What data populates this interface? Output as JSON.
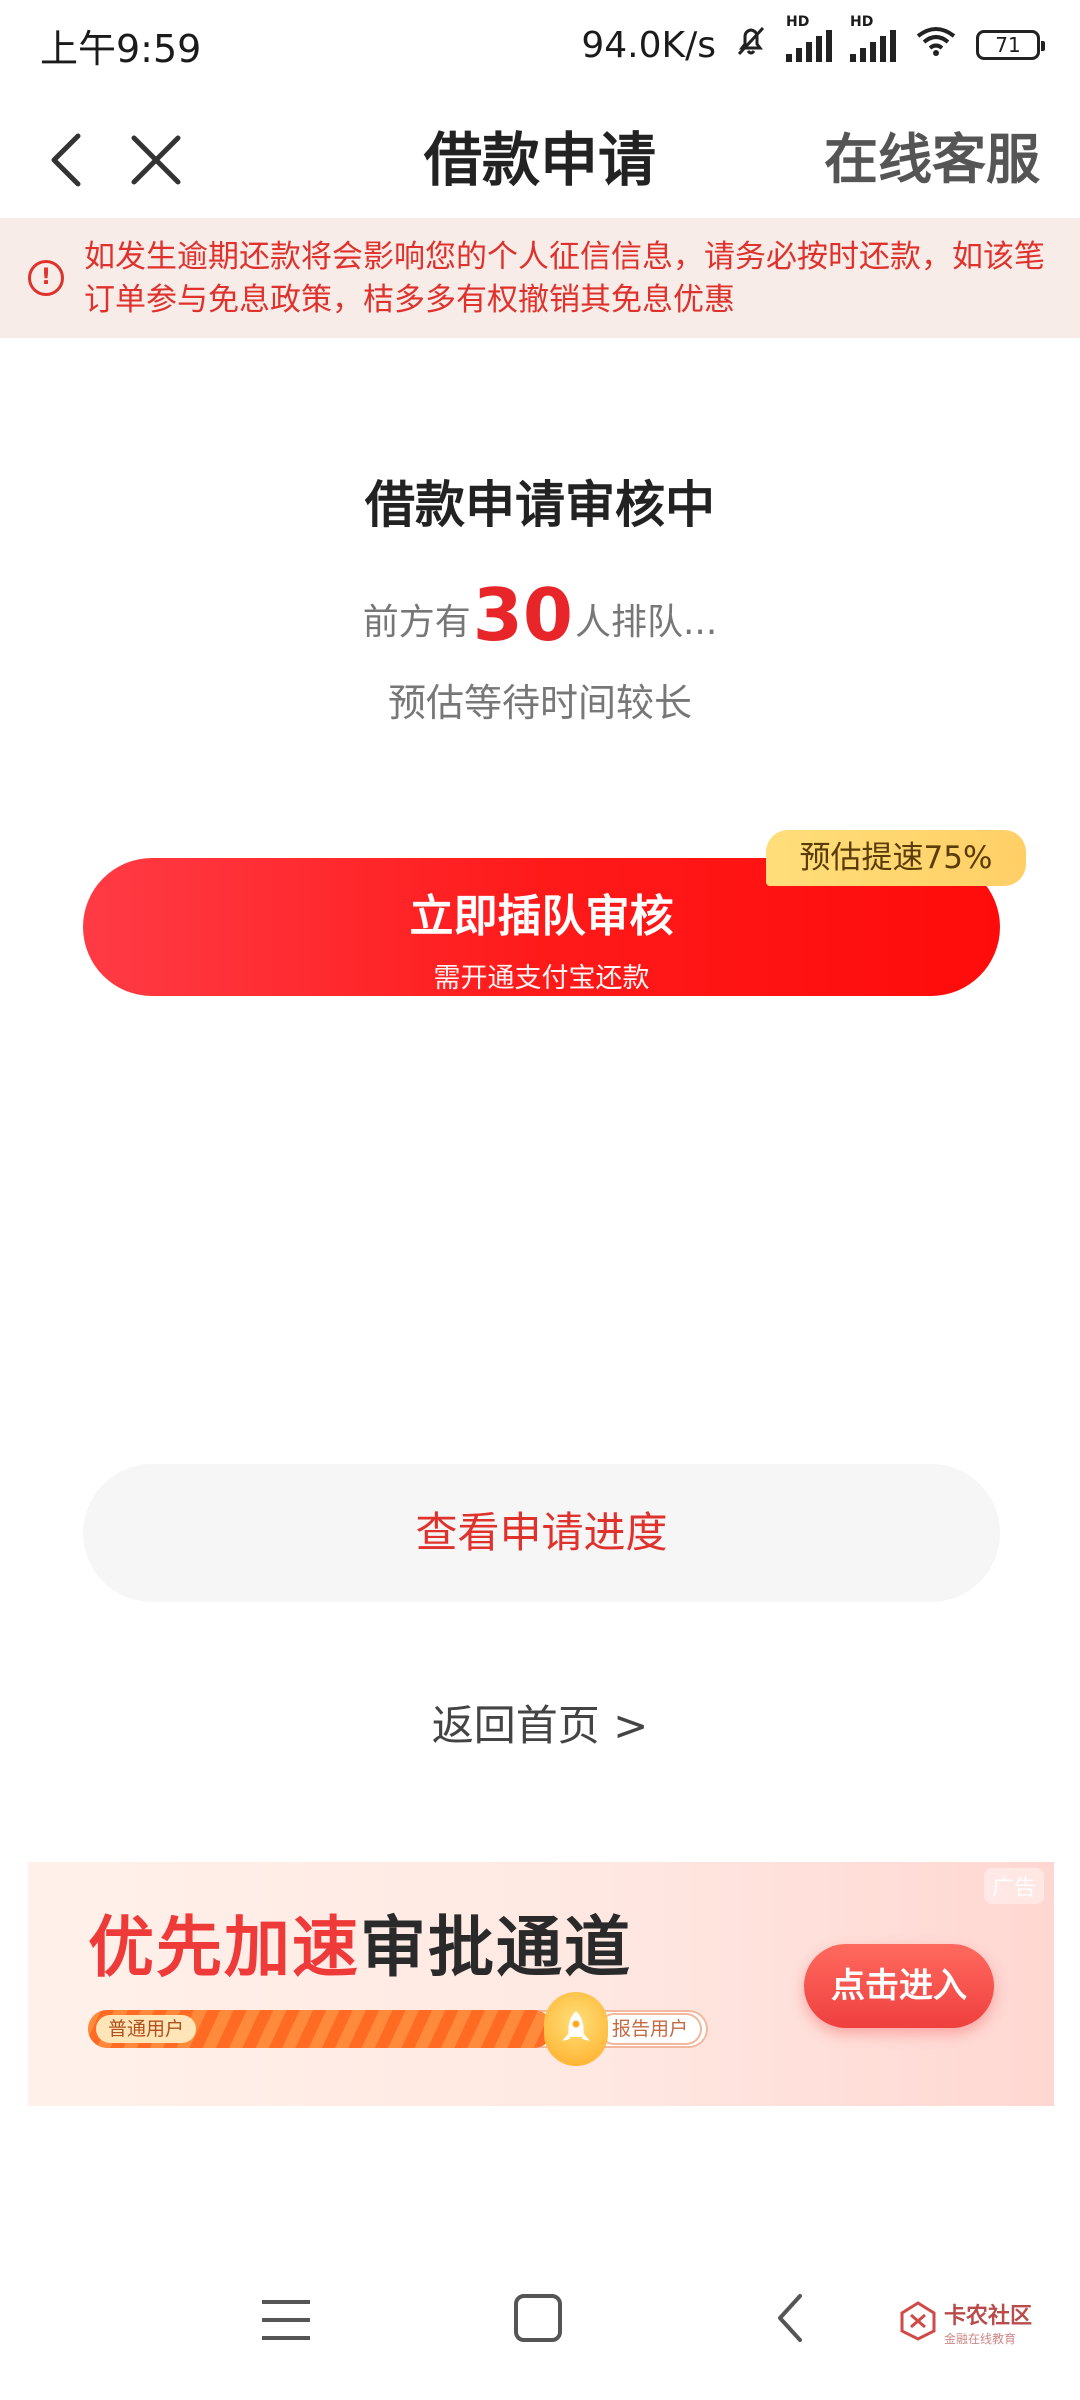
{
  "status_bar": {
    "time": "上午9:59",
    "net_speed": "94.0K/s",
    "hd_label": "HD",
    "battery": "71"
  },
  "nav": {
    "title": "借款申请",
    "service": "在线客服"
  },
  "notice": {
    "icon_symbol": "!",
    "text": "如发生逾期还款将会影响您的个人征信信息，请务必按时还款，如该笔订单参与免息政策，桔多多有权撤销其免息优惠"
  },
  "status": {
    "title": "借款申请审核中",
    "queue_prefix": "前方有",
    "queue_count": "30",
    "queue_suffix": "人排队...",
    "wait_text": "预估等待时间较长"
  },
  "primary_button": {
    "label": "立即插队审核",
    "sub_label": "需开通支付宝还款",
    "badge": "预估提速75%"
  },
  "secondary": {
    "progress_label": "查看申请进度",
    "home_link": "返回首页 >"
  },
  "banner": {
    "ad_tag": "广告",
    "title_accent": "优先加速",
    "title_rest": "审批通道",
    "from_label": "普通用户",
    "to_label": "报告用户",
    "progress": 0.75,
    "enter_label": "点击进入"
  },
  "watermark": {
    "text": "卡农社区",
    "sub": "金融在线教育"
  },
  "colors": {
    "accent_red": "#e8262a",
    "notice_bg": "#f7ece8",
    "badge_yellow": "#ffd56e"
  }
}
